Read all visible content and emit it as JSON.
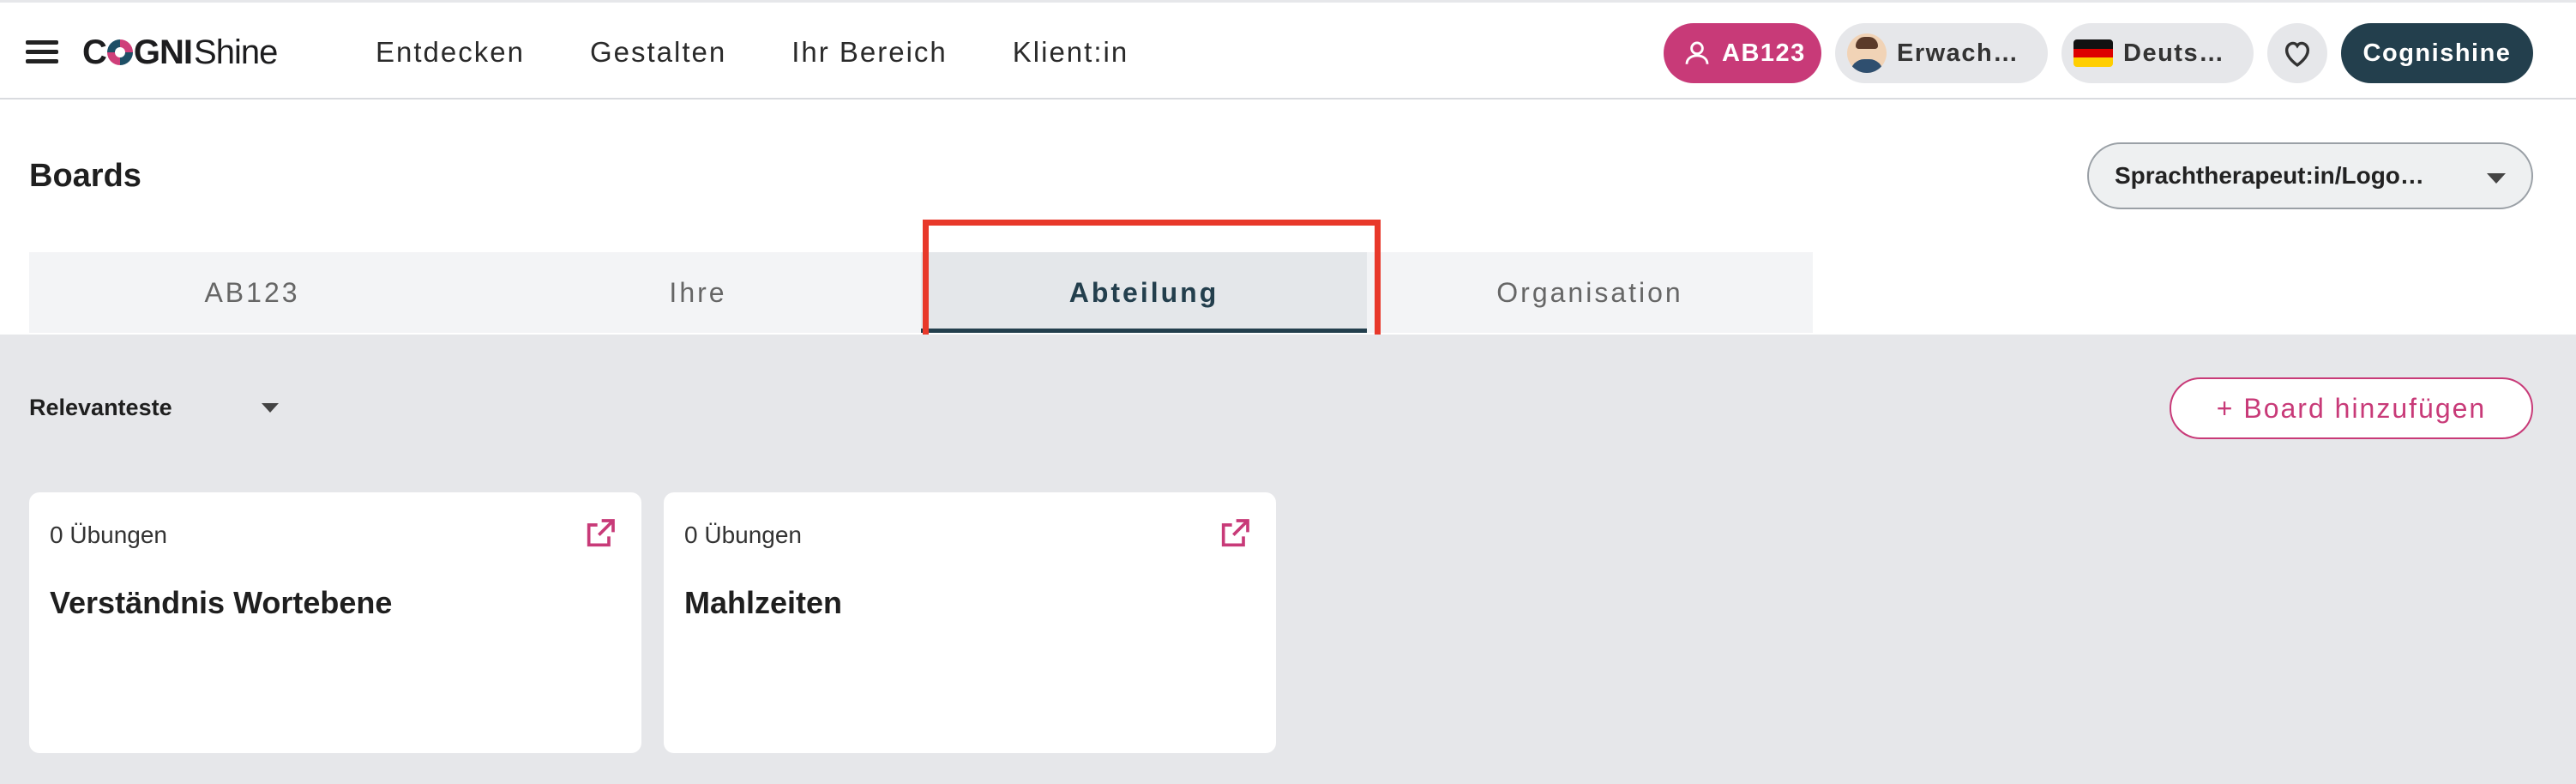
{
  "topbar": {
    "logo_bold": "C",
    "logo_bold2": "GNI",
    "logo_light": "Shine",
    "nav": [
      "Entdecken",
      "Gestalten",
      "Ihr Bereich",
      "Klient:in"
    ],
    "user_pill": "AB123",
    "audience_pill": "Erwach…",
    "language_pill": "Deuts…",
    "brand_button": "Cognishine",
    "icons": {
      "menu": "hamburger-icon",
      "user": "user-icon",
      "favorites": "heart-icon",
      "language_flag": "german-flag-icon",
      "audience_avatar": "adult-avatar-icon"
    }
  },
  "header": {
    "title": "Boards",
    "role_select": "Sprachtherapeut:in/Logo…"
  },
  "tabs": [
    {
      "label": "AB123",
      "active": false
    },
    {
      "label": "Ihre",
      "active": false
    },
    {
      "label": "Abteilung",
      "active": true
    },
    {
      "label": "Organisation",
      "active": false
    }
  ],
  "toolbar": {
    "sort_label": "Relevanteste",
    "add_board_label": "+ Board hinzufügen"
  },
  "cards": [
    {
      "count": "0 Übungen",
      "title": "Verständnis Wortebene"
    },
    {
      "count": "0 Übungen",
      "title": "Mahlzeiten"
    }
  ],
  "colors": {
    "accent": "#c83a78",
    "dark": "#233f4d",
    "highlight": "#e8382a",
    "content_bg": "#e6e7ea"
  }
}
